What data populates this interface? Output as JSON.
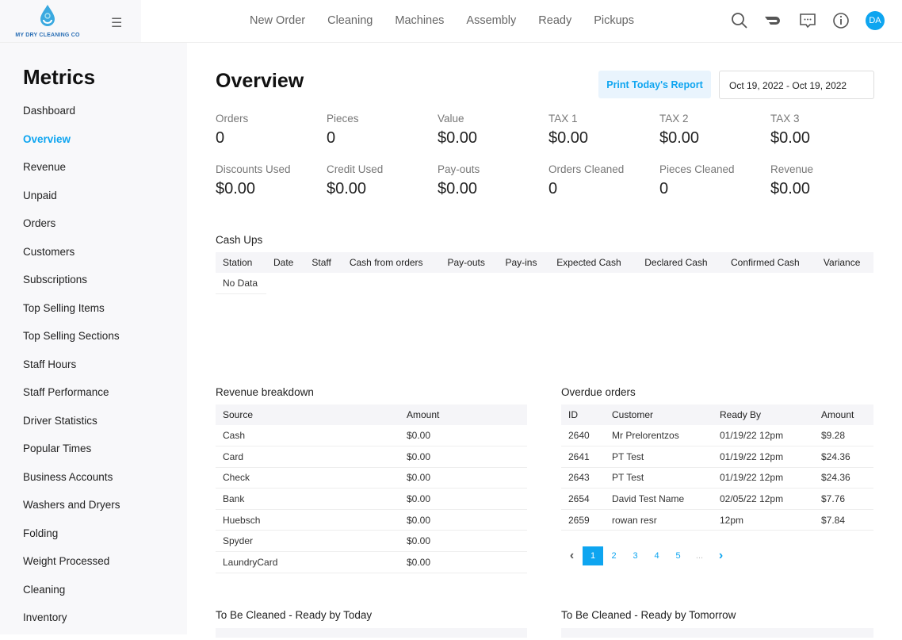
{
  "brand": {
    "name": "MY DRY CLEANING CO"
  },
  "nav": [
    "New Order",
    "Cleaning",
    "Machines",
    "Assembly",
    "Ready",
    "Pickups"
  ],
  "user": {
    "initials": "DA"
  },
  "sidebar": {
    "title": "Metrics",
    "items": [
      "Dashboard",
      "Overview",
      "Revenue",
      "Unpaid",
      "Orders",
      "Customers",
      "Subscriptions",
      "Top Selling Items",
      "Top Selling Sections",
      "Staff Hours",
      "Staff Performance",
      "Driver Statistics",
      "Popular Times",
      "Business Accounts",
      "Washers and Dryers",
      "Folding",
      "Weight Processed",
      "Cleaning",
      "Inventory"
    ],
    "active": "Overview"
  },
  "main": {
    "title": "Overview",
    "print_label": "Print Today's Report",
    "date_range": "Oct 19, 2022 - Oct 19, 2022",
    "stats": [
      {
        "label": "Orders",
        "value": "0"
      },
      {
        "label": "Pieces",
        "value": "0"
      },
      {
        "label": "Value",
        "value": "$0.00"
      },
      {
        "label": "TAX 1",
        "value": "$0.00"
      },
      {
        "label": "TAX 2",
        "value": "$0.00"
      },
      {
        "label": "TAX 3",
        "value": "$0.00"
      },
      {
        "label": "Discounts Used",
        "value": "$0.00"
      },
      {
        "label": "Credit Used",
        "value": "$0.00"
      },
      {
        "label": "Pay-outs",
        "value": "$0.00"
      },
      {
        "label": "Orders Cleaned",
        "value": "0"
      },
      {
        "label": "Pieces Cleaned",
        "value": "0"
      },
      {
        "label": "Revenue",
        "value": "$0.00"
      }
    ],
    "cashups": {
      "title": "Cash Ups",
      "headers": [
        "Station",
        "Date",
        "Staff",
        "Cash from orders",
        "Pay-outs",
        "Pay-ins",
        "Expected Cash",
        "Declared Cash",
        "Confirmed Cash",
        "Variance"
      ],
      "empty": "No Data"
    },
    "revenue": {
      "title": "Revenue breakdown",
      "headers": [
        "Source",
        "Amount"
      ],
      "rows": [
        [
          "Cash",
          "$0.00"
        ],
        [
          "Card",
          "$0.00"
        ],
        [
          "Check",
          "$0.00"
        ],
        [
          "Bank",
          "$0.00"
        ],
        [
          "Huebsch",
          "$0.00"
        ],
        [
          "Spyder",
          "$0.00"
        ],
        [
          "LaundryCard",
          "$0.00"
        ]
      ]
    },
    "overdue": {
      "title": "Overdue orders",
      "headers": [
        "ID",
        "Customer",
        "Ready By",
        "Amount"
      ],
      "rows": [
        [
          "2640",
          "Mr Prelorentzos",
          "01/19/22 12pm",
          "$9.28"
        ],
        [
          "2641",
          "PT Test",
          "01/19/22 12pm",
          "$24.36"
        ],
        [
          "2643",
          "PT Test",
          "01/19/22 12pm",
          "$24.36"
        ],
        [
          "2654",
          "David Test Name",
          "02/05/22 12pm",
          "$7.76"
        ],
        [
          "2659",
          "rowan resr",
          "12pm",
          "$7.84"
        ]
      ],
      "pages": [
        "1",
        "2",
        "3",
        "4",
        "5",
        "..."
      ],
      "current_page": "1"
    },
    "today": {
      "title": "To Be Cleaned - Ready by Today"
    },
    "tomorrow": {
      "title": "To Be Cleaned - Ready by Tomorrow"
    }
  }
}
